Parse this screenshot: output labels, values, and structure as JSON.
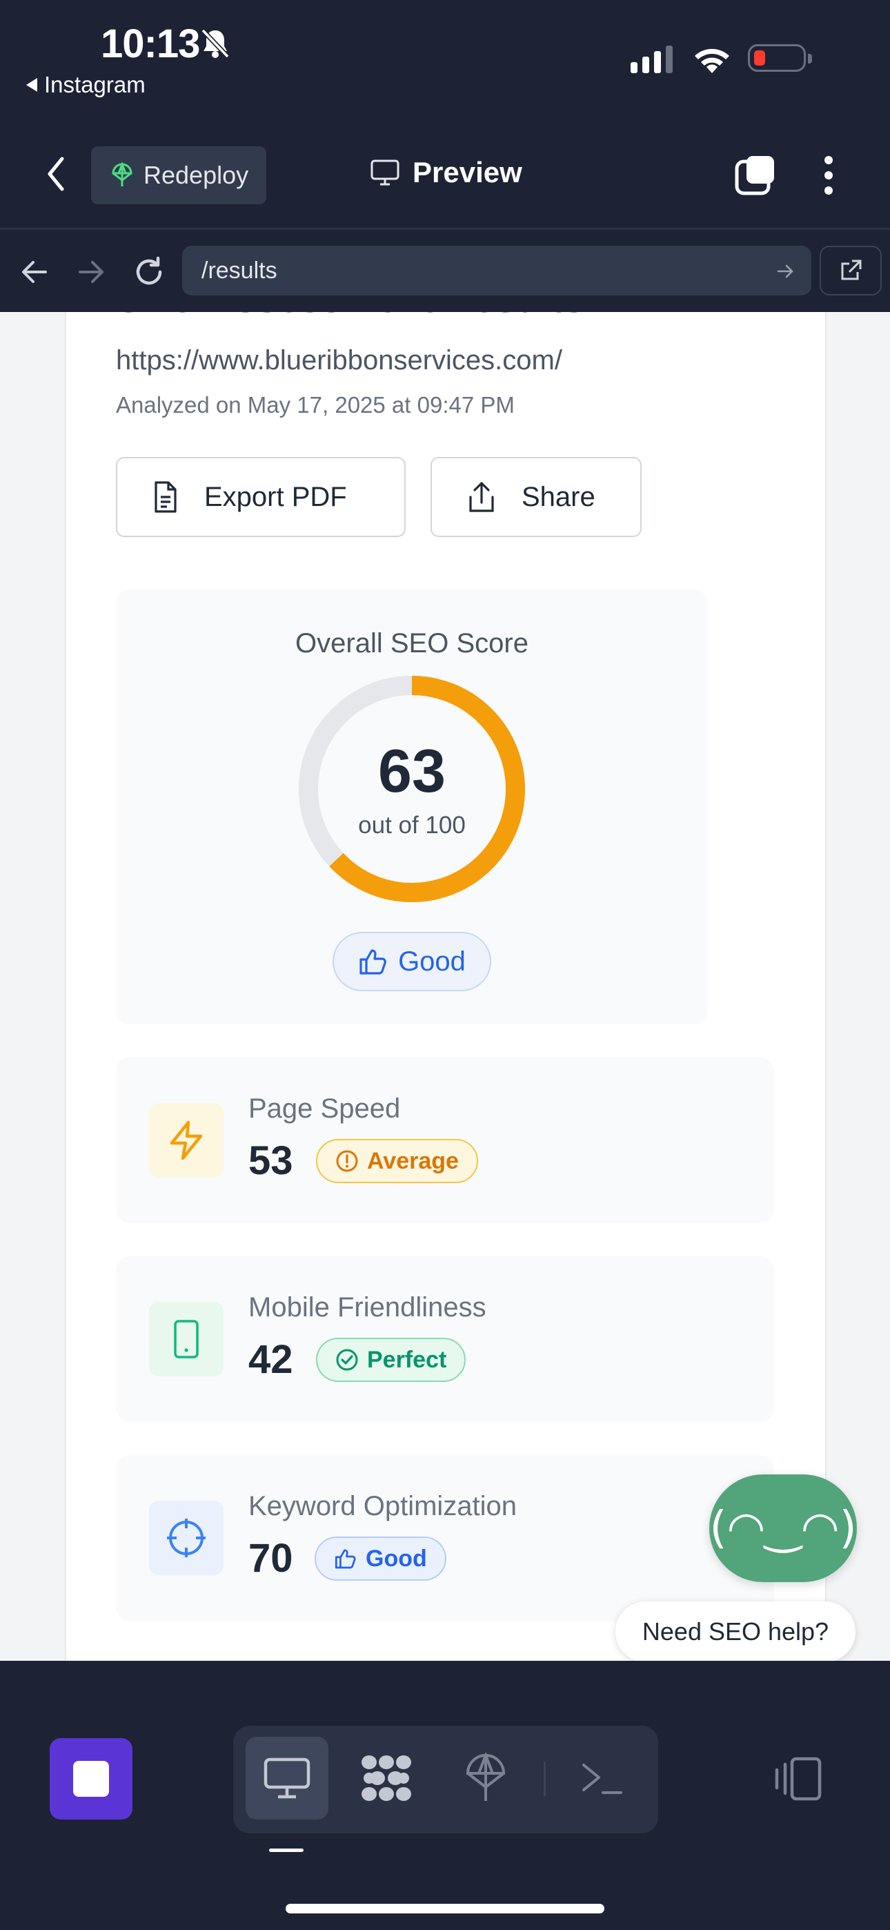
{
  "status_bar": {
    "time": "10:13",
    "back_app": "Instagram"
  },
  "app_header": {
    "redeploy_label": "Redeploy",
    "preview_label": "Preview"
  },
  "browser": {
    "url": "/results"
  },
  "results": {
    "title": "SEO Assessment Results",
    "site_url": "https://www.blueribbonservices.com/",
    "analyzed": "Analyzed on May 17, 2025 at 09:47 PM",
    "export_label": "Export PDF",
    "share_label": "Share",
    "overall": {
      "title": "Overall SEO Score",
      "score": 63,
      "score_text": "63",
      "out_of": "out of 100",
      "rating": "Good",
      "accent": "#f59e0b"
    },
    "metrics": [
      {
        "label": "Page Speed",
        "value": "53",
        "badge": "Average",
        "icon": "lightning-icon",
        "color": "#f59e0b"
      },
      {
        "label": "Mobile Friendliness",
        "value": "42",
        "badge": "Perfect",
        "icon": "smartphone-icon",
        "color": "#10b981"
      },
      {
        "label": "Keyword Optimization",
        "value": "70",
        "badge": "Good",
        "icon": "crosshair-icon",
        "color": "#3b82f6"
      }
    ]
  },
  "assistant": {
    "face": "(◠‿◠)",
    "help_text": "Need SEO help?"
  },
  "colors": {
    "background": "#1d2234",
    "panel": "#323a4e",
    "stop_button": "#5b34d6",
    "assistant": "#52a47a"
  }
}
